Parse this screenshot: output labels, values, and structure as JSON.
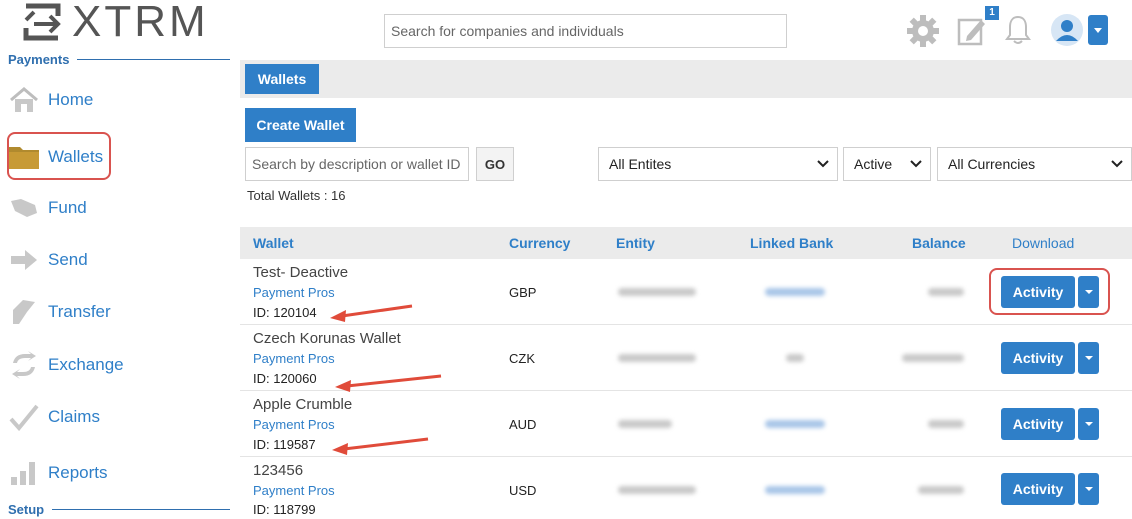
{
  "app": {
    "logo_text": "XTRM"
  },
  "header": {
    "search_placeholder": "Search for companies and individuals",
    "notification_badge": "1"
  },
  "sidebar": {
    "section_payments": "Payments",
    "section_setup": "Setup",
    "items": [
      {
        "label": "Home",
        "icon": "home-icon"
      },
      {
        "label": "Wallets",
        "icon": "folder-icon"
      },
      {
        "label": "Fund",
        "icon": "fund-icon"
      },
      {
        "label": "Send",
        "icon": "arrow-right-icon"
      },
      {
        "label": "Transfer",
        "icon": "transfer-icon"
      },
      {
        "label": "Exchange",
        "icon": "exchange-icon"
      },
      {
        "label": "Claims",
        "icon": "check-icon"
      },
      {
        "label": "Reports",
        "icon": "bar-chart-icon"
      }
    ]
  },
  "main": {
    "tab": "Wallets",
    "create_button": "Create Wallet",
    "filter_placeholder": "Search by description or wallet ID",
    "go_button": "GO",
    "entity_select": "All Entites",
    "status_select": "Active",
    "currency_select": "All Currencies",
    "total": "Total Wallets : 16"
  },
  "table": {
    "headers": {
      "wallet": "Wallet",
      "currency": "Currency",
      "entity": "Entity",
      "linked_bank": "Linked Bank",
      "balance": "Balance",
      "download": "Download"
    },
    "action_label": "Activity",
    "rows": [
      {
        "name": "Test- Deactive",
        "company": "Payment Pros",
        "id": "ID: 120104",
        "currency": "GBP"
      },
      {
        "name": "Czech Korunas Wallet",
        "company": "Payment Pros",
        "id": "ID: 120060",
        "currency": "CZK"
      },
      {
        "name": "Apple Crumble",
        "company": "Payment Pros",
        "id": "ID: 119587",
        "currency": "AUD"
      },
      {
        "name": "123456",
        "company": "Payment Pros",
        "id": "ID: 118799",
        "currency": "USD"
      }
    ]
  },
  "colors": {
    "accent": "#2f7fc8",
    "highlight": "#d9534f",
    "header_bg": "#ebebeb"
  }
}
